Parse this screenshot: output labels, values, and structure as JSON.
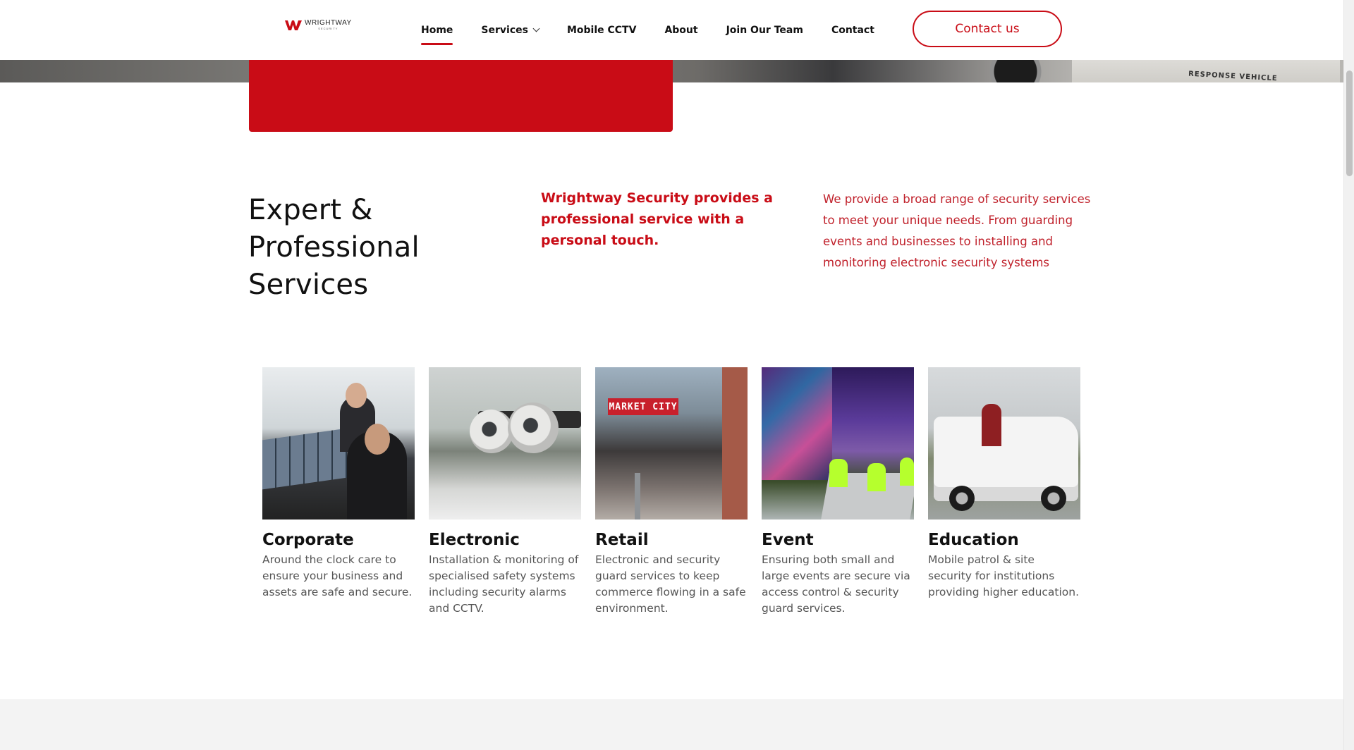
{
  "brand": {
    "logo_text": "WRIGHTWAY",
    "logo_subtext": "SECURITY",
    "accent_color": "#c90c16"
  },
  "nav": {
    "items": [
      {
        "label": "Home",
        "active": true
      },
      {
        "label": "Services",
        "has_dropdown": true
      },
      {
        "label": "Mobile CCTV"
      },
      {
        "label": "About"
      },
      {
        "label": "Join Our Team"
      },
      {
        "label": "Contact"
      }
    ],
    "cta_label": "Contact us"
  },
  "hero": {
    "vehicle_text": "RESPONSE VEHICLE"
  },
  "intro": {
    "title": "Expert & Professional Services",
    "lead": "Wrightway Security provides a professional service with a personal touch.",
    "body": "We provide a broad range of security services to meet your unique needs. From guarding events and businesses to installing and monitoring electronic security systems"
  },
  "services": [
    {
      "title": "Corporate",
      "description": "Around the clock care to ensure your business and assets are safe and secure.",
      "image": "corporate-monitoring-photo"
    },
    {
      "title": "Electronic",
      "description": "Installation & monitoring of specialised safety systems including security alarms and CCTV.",
      "image": "cctv-cameras-photo"
    },
    {
      "title": "Retail",
      "description": "Electronic and security guard services to keep commerce flowing in a safe environment.",
      "image": "market-city-photo",
      "sign_text": "MARKET CITY"
    },
    {
      "title": "Event",
      "description": "Ensuring both small and large events are secure via access control & security guard services.",
      "image": "event-stage-photo"
    },
    {
      "title": "Education",
      "description": "Mobile patrol & site security for institutions providing higher education.",
      "image": "patrol-vehicle-photo"
    }
  ]
}
